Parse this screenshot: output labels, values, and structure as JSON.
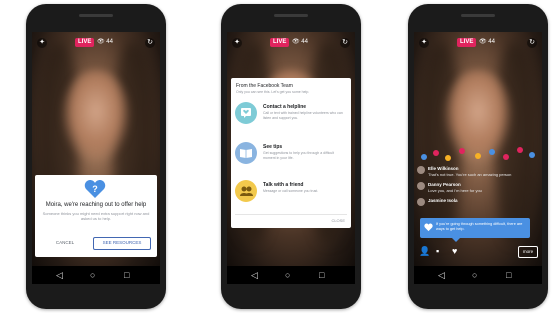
{
  "status": {
    "live_label": "LIVE",
    "viewers": "👁 44"
  },
  "nav": {
    "back_icon": "◁",
    "home_icon": "○",
    "recent_icon": "□"
  },
  "phone1": {
    "title": "Moira, we're reaching out to offer help",
    "body": "Someone thinks you might need extra support right now and asked us to help.",
    "cancel_label": "CANCEL",
    "see_resources_label": "SEE RESOURCES"
  },
  "phone2": {
    "sheet_title": "From the Facebook Team",
    "sheet_subtitle": "Only you can see this. Let's get you some help.",
    "options": [
      {
        "title": "Contact a helpline",
        "desc": "Call or text with trained helpline volunteers who can listen and support you.",
        "icon": "heart-chat-icon",
        "color": "#7ecbd6"
      },
      {
        "title": "See tips",
        "desc": "Get suggestions to help you through a difficult moment in your life.",
        "icon": "book-icon",
        "color": "#8ab4e0"
      },
      {
        "title": "Talk with a friend",
        "desc": "Message or call someone you trust.",
        "icon": "people-icon",
        "color": "#f2c94c"
      }
    ],
    "close_label": "CLOSE"
  },
  "phone3": {
    "comments": [
      {
        "name": "Elle Wilkinson",
        "text": "That's not true. You're such an amazing person"
      },
      {
        "name": "Danny Pearson",
        "text": "Love you, and I'm here for you"
      },
      {
        "name": "Jasmine Isola",
        "text": ""
      }
    ],
    "tooltip": "If you're going through something difficult, there are ways to get help.",
    "more_label": "more"
  }
}
